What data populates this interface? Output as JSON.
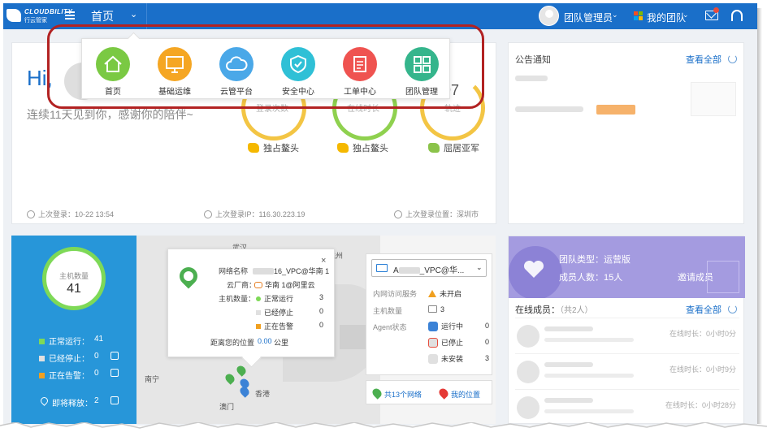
{
  "topbar": {
    "logo_text": "CLOUDBILITY",
    "logo_sub": "行云管家",
    "nav_home": "首页",
    "nav_chevron": "⌄",
    "user_name": "团队管理员",
    "user_chevron": "⌄",
    "team_name": "我的团队",
    "team_chevron": "⌄",
    "colors": {
      "bar": "#1a6fc9",
      "alert": "#e74c3c"
    }
  },
  "app_menu": [
    {
      "label": "首页",
      "color": "#7ac943",
      "icon": "home-icon"
    },
    {
      "label": "基础运维",
      "color": "#f5a623",
      "icon": "monitor-icon"
    },
    {
      "label": "云管平台",
      "color": "#4aa8e8",
      "icon": "cloud-icon"
    },
    {
      "label": "安全中心",
      "color": "#2fc0d6",
      "icon": "shield-icon"
    },
    {
      "label": "工单中心",
      "color": "#ef5350",
      "icon": "clipboard-icon"
    },
    {
      "label": "团队管理",
      "color": "#35b58c",
      "icon": "grid-icon"
    }
  ],
  "welcome": {
    "greeting": "Hi,",
    "tagline": "连续11天见到你，感谢你的陪伴~",
    "stats": [
      {
        "label": "登录次数",
        "value": ""
      },
      {
        "label": "在线时长",
        "value": ""
      },
      {
        "label": "轨迹",
        "value": "97"
      }
    ],
    "ranks": [
      "独占鳌头",
      "独占鳌头",
      "屈居亚军"
    ],
    "last_login": "上次登录：10-22 13:54",
    "last_ip": "上次登录IP：116.30.223.19",
    "last_location": "上次登录位置：深圳市"
  },
  "notice": {
    "title": "公告通知",
    "view_all": "查看全部"
  },
  "host": {
    "label": "主机数量",
    "value": "41",
    "stats": [
      {
        "label": "正常运行：",
        "value": "41",
        "color": "#7ed957"
      },
      {
        "label": "已经停止：",
        "value": "0",
        "color": "#e0e0e0"
      },
      {
        "label": "正在告警：",
        "value": "0",
        "color": "#f0a020"
      }
    ],
    "release_label": "即将释放：",
    "release_value": "2"
  },
  "map": {
    "cities": [
      "武汉",
      "杭州",
      "南宁",
      "香港",
      "澳门"
    ],
    "popup": {
      "net_label": "网络名称",
      "net_value_suffix": "16_VPC@华南 1",
      "vendor_label": "云厂商：",
      "vendor_value": "华南 1@阿里云",
      "host_label": "主机数量：",
      "rows": [
        {
          "label": "正常运行",
          "value": "3",
          "color": "#7ed957"
        },
        {
          "label": "已经停止",
          "value": "0",
          "color": "#e0e0e0"
        },
        {
          "label": "正在告警",
          "value": "0",
          "color": "#f0a020"
        }
      ],
      "distance_label": "距离您的位置",
      "distance_value": "0.00",
      "distance_unit": "公里",
      "close": "×"
    },
    "vpc": {
      "select_prefix": "A",
      "select_value": "_VPC@华...",
      "arrow": "⌄",
      "internet_label": "内网访问服务",
      "internet_value": "未开启",
      "host_label": "主机数量",
      "host_value": "3",
      "agent_label": "Agent状态",
      "agent_rows": [
        {
          "label": "运行中",
          "value": "0"
        },
        {
          "label": "已停止",
          "value": "0"
        },
        {
          "label": "未安装",
          "value": "3"
        }
      ]
    },
    "netbar": {
      "networks": "共13个网络",
      "my_location": "我的位置"
    }
  },
  "team": {
    "type": "团队类型：运营版",
    "members": "成员人数：15人",
    "invite": "邀请成员",
    "online_title": "在线成员：",
    "online_count": "（共2人）",
    "view_all": "查看全部",
    "online": [
      {
        "time": "在线时长：0小时0分"
      },
      {
        "time": "在线时长：0小时9分"
      },
      {
        "time": "在线时长：0小时28分"
      }
    ]
  }
}
